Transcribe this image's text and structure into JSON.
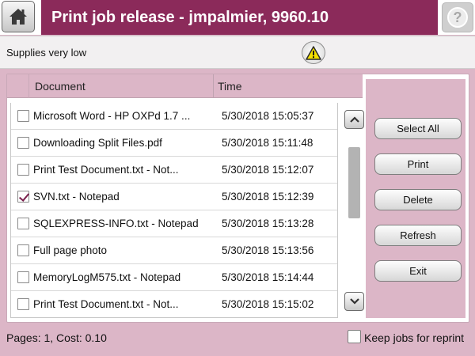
{
  "header": {
    "title": "Print job release - jmpalmier, 9960.10",
    "home_icon": "home-icon",
    "help_icon": "help-icon",
    "help_glyph": "?"
  },
  "status": {
    "message": "Supplies very low",
    "warning_icon": "warning-icon"
  },
  "table": {
    "columns": [
      "Document",
      "Time"
    ],
    "rows": [
      {
        "document": "Microsoft Word - HP OXPd 1.7 ...",
        "time": "5/30/2018 15:05:37",
        "checked": false
      },
      {
        "document": "Downloading Split Files.pdf",
        "time": "5/30/2018 15:11:48",
        "checked": false
      },
      {
        "document": "Print Test Document.txt - Not...",
        "time": "5/30/2018 15:12:07",
        "checked": false
      },
      {
        "document": "SVN.txt - Notepad",
        "time": "5/30/2018 15:12:39",
        "checked": true
      },
      {
        "document": "SQLEXPRESS-INFO.txt - Notepad",
        "time": "5/30/2018 15:13:28",
        "checked": false
      },
      {
        "document": "Full page photo",
        "time": "5/30/2018 15:13:56",
        "checked": false
      },
      {
        "document": "MemoryLogM575.txt - Notepad",
        "time": "5/30/2018 15:14:44",
        "checked": false
      },
      {
        "document": "Print Test Document.txt - Not...",
        "time": "5/30/2018 15:15:02",
        "checked": false
      }
    ]
  },
  "actions": {
    "select_all": "Select All",
    "print": "Print",
    "delete": "Delete",
    "refresh": "Refresh",
    "exit": "Exit"
  },
  "footer": {
    "summary": "Pages: 1, Cost: 0.10",
    "keep_jobs_label": "Keep jobs for reprint",
    "keep_jobs_checked": false
  },
  "colors": {
    "title_bar": "#8b2a5a",
    "background": "#dcb6c7",
    "checkmark": "#7a1f4c"
  }
}
